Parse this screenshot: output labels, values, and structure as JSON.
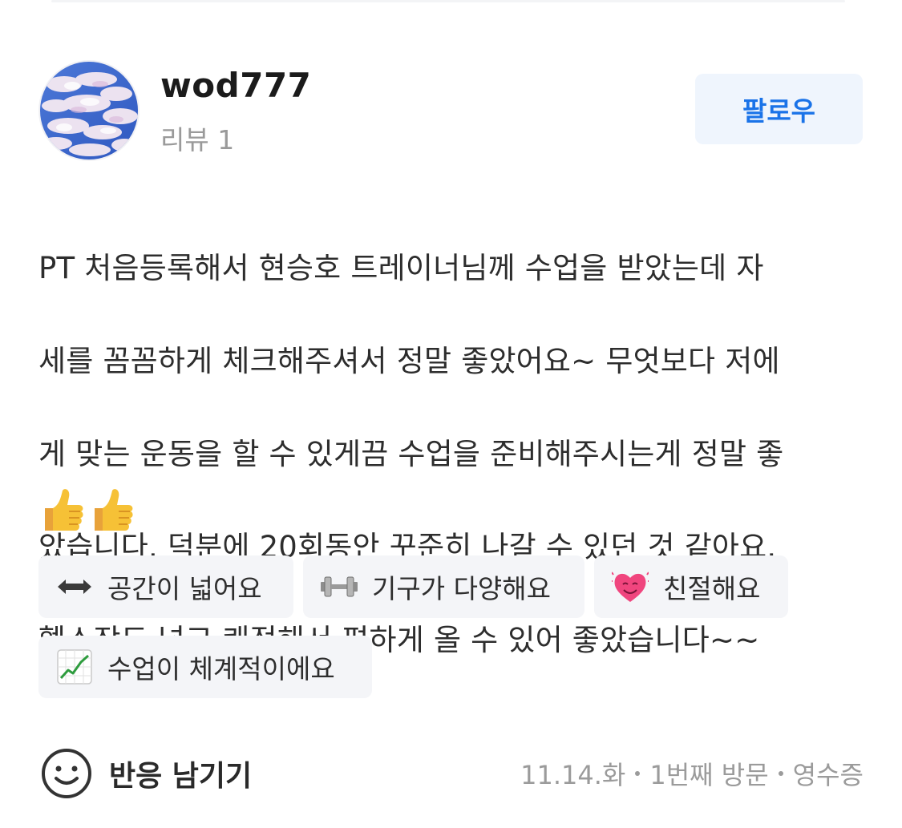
{
  "profile": {
    "username": "wod777",
    "review_count": "리뷰 1",
    "follow_label": "팔로우"
  },
  "review": {
    "lines": [
      "PT 처음등록해서 현승호 트레이너님께 수업을 받았는데 자",
      "세를 꼼꼼하게 체크해주셔서 정말 좋았어요~ 무엇보다 저에",
      "게 맞는 운동을 할 수 있게끔 수업을 준비해주시는게 정말 좋",
      "았습니다. 덕분에 20회동안 꾸준히 나갈 수 있던 것 같아요.",
      "헬스장도 넓고 쾌적해서 편하게 올 수 있어 좋았습니다~~"
    ],
    "emojis": [
      "👍",
      "👍"
    ]
  },
  "tags": [
    {
      "icon": "left-right-arrow-icon",
      "label": "공간이 넓어요"
    },
    {
      "icon": "dumbbell-icon",
      "label": "기구가 다양해요"
    },
    {
      "icon": "smiling-heart-icon",
      "label": "친절해요"
    },
    {
      "icon": "chart-increasing-icon",
      "label": "수업이 체계적이에요"
    }
  ],
  "footer": {
    "react_label": "반응 남기기",
    "date": "11.14.화",
    "visit": "1번째 방문",
    "receipt": "영수증"
  },
  "colors": {
    "follow_bg": "#eff5fd",
    "follow_text": "#1a73e8",
    "tag_bg": "#f4f5f8",
    "meta_text": "#9b9b9b"
  }
}
